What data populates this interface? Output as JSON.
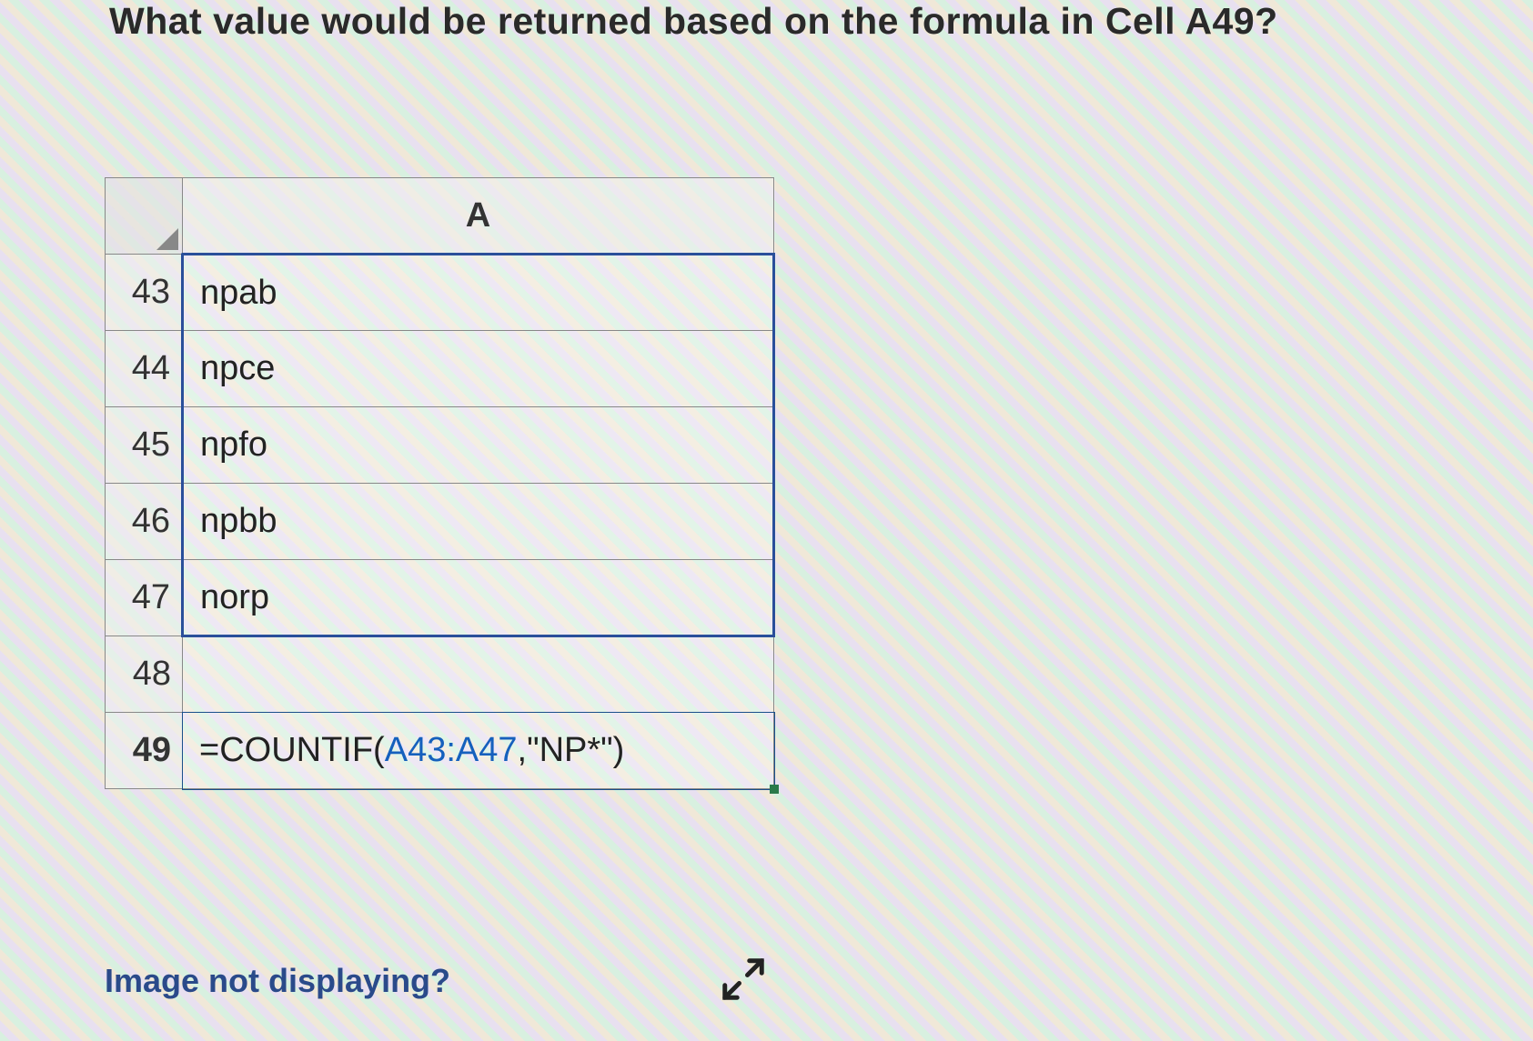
{
  "question": "What value would be returned based on the formula in Cell A49?",
  "column_header": "A",
  "rows": [
    {
      "num": "43",
      "value": "npab"
    },
    {
      "num": "44",
      "value": "npce"
    },
    {
      "num": "45",
      "value": "npfo"
    },
    {
      "num": "46",
      "value": "npbb"
    },
    {
      "num": "47",
      "value": "norp"
    },
    {
      "num": "48",
      "value": ""
    }
  ],
  "formula_row": {
    "num": "49",
    "prefix": "=COUNTIF(",
    "ref": "A43:A47",
    "suffix": ",\"NP*\")"
  },
  "help_link": "Image not displaying?",
  "chart_data": {
    "type": "table",
    "title": "Spreadsheet excerpt",
    "columns": [
      "A"
    ],
    "row_numbers": [
      43,
      44,
      45,
      46,
      47,
      48,
      49
    ],
    "cells": {
      "A43": "npab",
      "A44": "npce",
      "A45": "npfo",
      "A46": "npbb",
      "A47": "norp",
      "A48": "",
      "A49": "=COUNTIF(A43:A47,\"NP*\")"
    },
    "selected_range": "A43:A47",
    "formula_cell": "A49"
  }
}
